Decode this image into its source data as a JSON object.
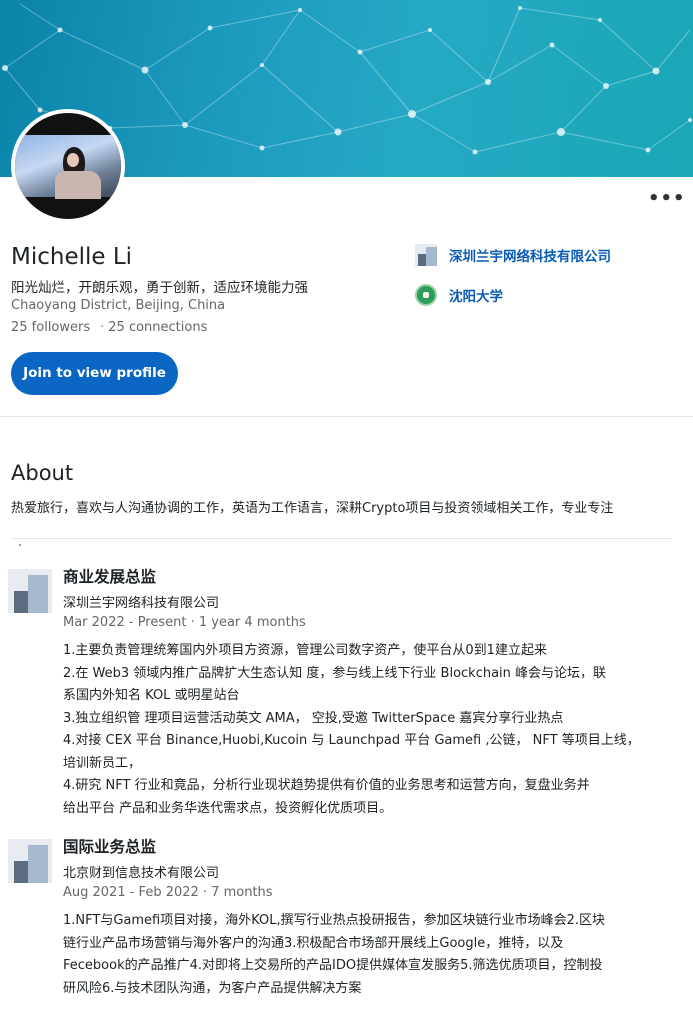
{
  "profile": {
    "name": "Michelle Li",
    "headline": "阳光灿烂，开朗乐观，勇于创新，适应环境能力强",
    "location": "Chaoyang District, Beijing, China",
    "followers": "25 followers",
    "connections": "25 connections",
    "join_label": "Join to view profile",
    "more_label": "•••"
  },
  "orgs": {
    "company": "深圳兰宇网络科技有限公司",
    "school": "沈阳大学"
  },
  "about": {
    "title": "About",
    "text": "热爱旅行，喜欢与人沟通协调的工作，英语为工作语言，深耕Crypto项目与投资领域相关工作，专业专注"
  },
  "experience": [
    {
      "title": "商业发展总监",
      "company": "深圳兰宇网络科技有限公司",
      "dates": "Mar 2022 - Present · 1 year 4 months",
      "lines": [
        "1.主要负责管理统筹国内外项目方资源，管理公司数字资产，使平台从0到1建立起来",
        "2.在 Web3 领域内推广品牌扩大生态认知 度，参与线上线下行业 Blockchain 峰会与论坛，联",
        "系国内外知名 KOL 或明星站台",
        "3.独立组织管 理项目运营活动英文 AMA， 空投,受邀 TwitterSpace 嘉宾分享行业热点",
        "4.对接 CEX 平台 Binance,Huobi,Kucoin 与 Launchpad 平台 Gamefi ,公链， NFT 等项目上线，",
        "培训新员工，",
        "4.研究 NFT 行业和竟品，分析行业现状趋势提供有价值的业务思考和运营方向，复盘业务并",
        "给出平台 产品和业务华迭代需求点，投资孵化优质项目。"
      ]
    },
    {
      "title": "国际业务总监",
      "company": "北京财到信息技术有限公司",
      "dates": "Aug 2021 - Feb 2022 · 7 months",
      "lines": [
        "1.NFT与Gamefi项目对接，海外KOL,撰写行业热点投研报告，参加区块链行业市场峰会2.区块",
        "链行业产品市场营销与海外客户的沟通3.积极配合市场部开展线上Google，推特，以及",
        "Fecebook的产品推广4.对即将上交易所的产品IDO提供媒体宣发服务5.筛选优质项目，控制投",
        "研风险6.与技术团队沟通，为客户产品提供解决方案"
      ]
    }
  ]
}
